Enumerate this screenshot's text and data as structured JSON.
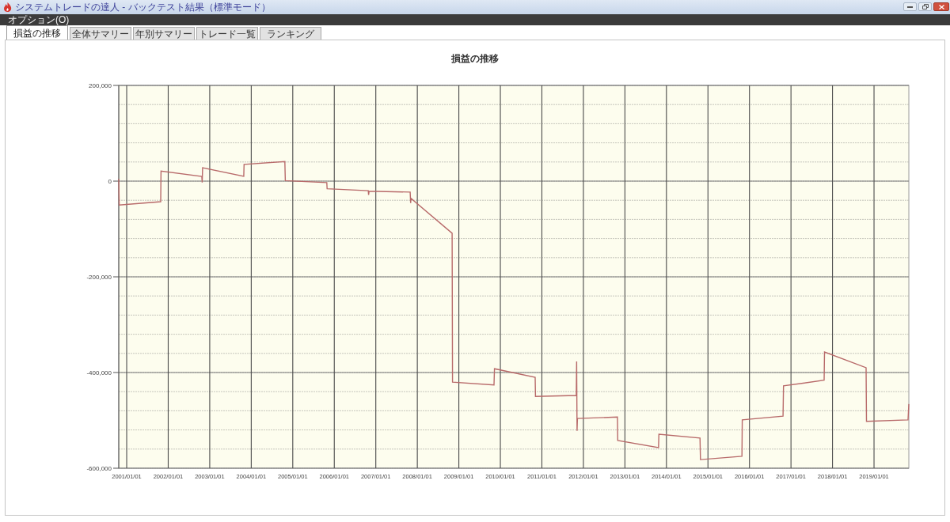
{
  "window": {
    "title": "システムトレードの達人 - バックテスト結果（標準モード）"
  },
  "menu_bar": {
    "items": [
      {
        "label": "オプション(O)"
      }
    ]
  },
  "tabs": [
    {
      "label": "損益の推移",
      "selected": true
    },
    {
      "label": "全体サマリー",
      "selected": false
    },
    {
      "label": "年別サマリー",
      "selected": false
    },
    {
      "label": "トレード一覧",
      "selected": false
    },
    {
      "label": "ランキング",
      "selected": false
    }
  ],
  "chart_panel": {
    "chart_data": {
      "type": "line",
      "title": "損益の推移",
      "grid": true,
      "x": [
        "2000-10-23",
        "2000-10-27",
        "2001-10-27",
        "2001-10-30",
        "2002-10-23",
        "2002-10-27",
        "2002-10-30",
        "2003-10-27",
        "2003-10-30",
        "2004-10-23",
        "2004-10-27",
        "2005-10-27",
        "2005-10-30",
        "2006-10-27",
        "2006-10-30",
        "2006-11-03",
        "2007-10-30",
        "2007-11-03",
        "2007-11-06",
        "2008-11-03",
        "2008-11-06",
        "2009-11-06",
        "2009-11-10",
        "2010-11-03",
        "2010-11-06",
        "2011-10-30",
        "2011-11-03",
        "2011-11-06",
        "2011-11-10",
        "2012-10-27",
        "2012-10-30",
        "2013-10-23",
        "2013-10-27",
        "2014-10-23",
        "2014-10-27",
        "2015-10-27",
        "2015-10-30",
        "2016-10-23",
        "2016-10-27",
        "2017-10-19",
        "2017-10-23",
        "2018-10-23",
        "2018-10-27",
        "2019-10-27",
        "2019-11-03"
      ],
      "series": [
        {
          "color": "#b86a6a",
          "values": [
            5000,
            -50000,
            -43000,
            21000,
            10000,
            -3000,
            28000,
            10000,
            35000,
            41000,
            1000,
            -3000,
            -16000,
            -20000,
            -29000,
            -21000,
            -23000,
            -46000,
            -36000,
            -109000,
            -420000,
            -426000,
            -392000,
            -410000,
            -450000,
            -448000,
            -377000,
            -522000,
            -496000,
            -493000,
            -542000,
            -557000,
            -529000,
            -537000,
            -582000,
            -575000,
            -499000,
            -491000,
            -428000,
            -416000,
            -357000,
            -390000,
            -502000,
            -499000,
            -466000
          ]
        }
      ],
      "xlim": [
        "2000-10-23",
        "2019-11-03"
      ],
      "ylim": [
        -600000,
        200000
      ],
      "xticks": [
        {
          "value": "2001-01-01",
          "label": "2001/01/01"
        },
        {
          "value": "2002-01-01",
          "label": "2002/01/01"
        },
        {
          "value": "2003-01-01",
          "label": "2003/01/01"
        },
        {
          "value": "2004-01-01",
          "label": "2004/01/01"
        },
        {
          "value": "2005-01-01",
          "label": "2005/01/01"
        },
        {
          "value": "2006-01-01",
          "label": "2006/01/01"
        },
        {
          "value": "2007-01-01",
          "label": "2007/01/01"
        },
        {
          "value": "2008-01-01",
          "label": "2008/01/01"
        },
        {
          "value": "2009-01-01",
          "label": "2009/01/01"
        },
        {
          "value": "2010-01-01",
          "label": "2010/01/01"
        },
        {
          "value": "2011-01-01",
          "label": "2011/01/01"
        },
        {
          "value": "2012-01-01",
          "label": "2012/01/01"
        },
        {
          "value": "2013-01-01",
          "label": "2013/01/01"
        },
        {
          "value": "2014-01-01",
          "label": "2014/01/01"
        },
        {
          "value": "2015-01-01",
          "label": "2015/01/01"
        },
        {
          "value": "2016-01-01",
          "label": "2016/01/01"
        },
        {
          "value": "2017-01-01",
          "label": "2017/01/01"
        },
        {
          "value": "2018-01-01",
          "label": "2018/01/01"
        },
        {
          "value": "2019-01-01",
          "label": "2019/01/01"
        }
      ],
      "yticks": [
        {
          "value": 200000,
          "label": "200,000"
        },
        {
          "value": 0,
          "label": "0"
        },
        {
          "value": -200000,
          "label": "-200,000"
        },
        {
          "value": -400000,
          "label": "-400,000"
        },
        {
          "value": -600000,
          "label": "-600,000"
        }
      ]
    }
  }
}
